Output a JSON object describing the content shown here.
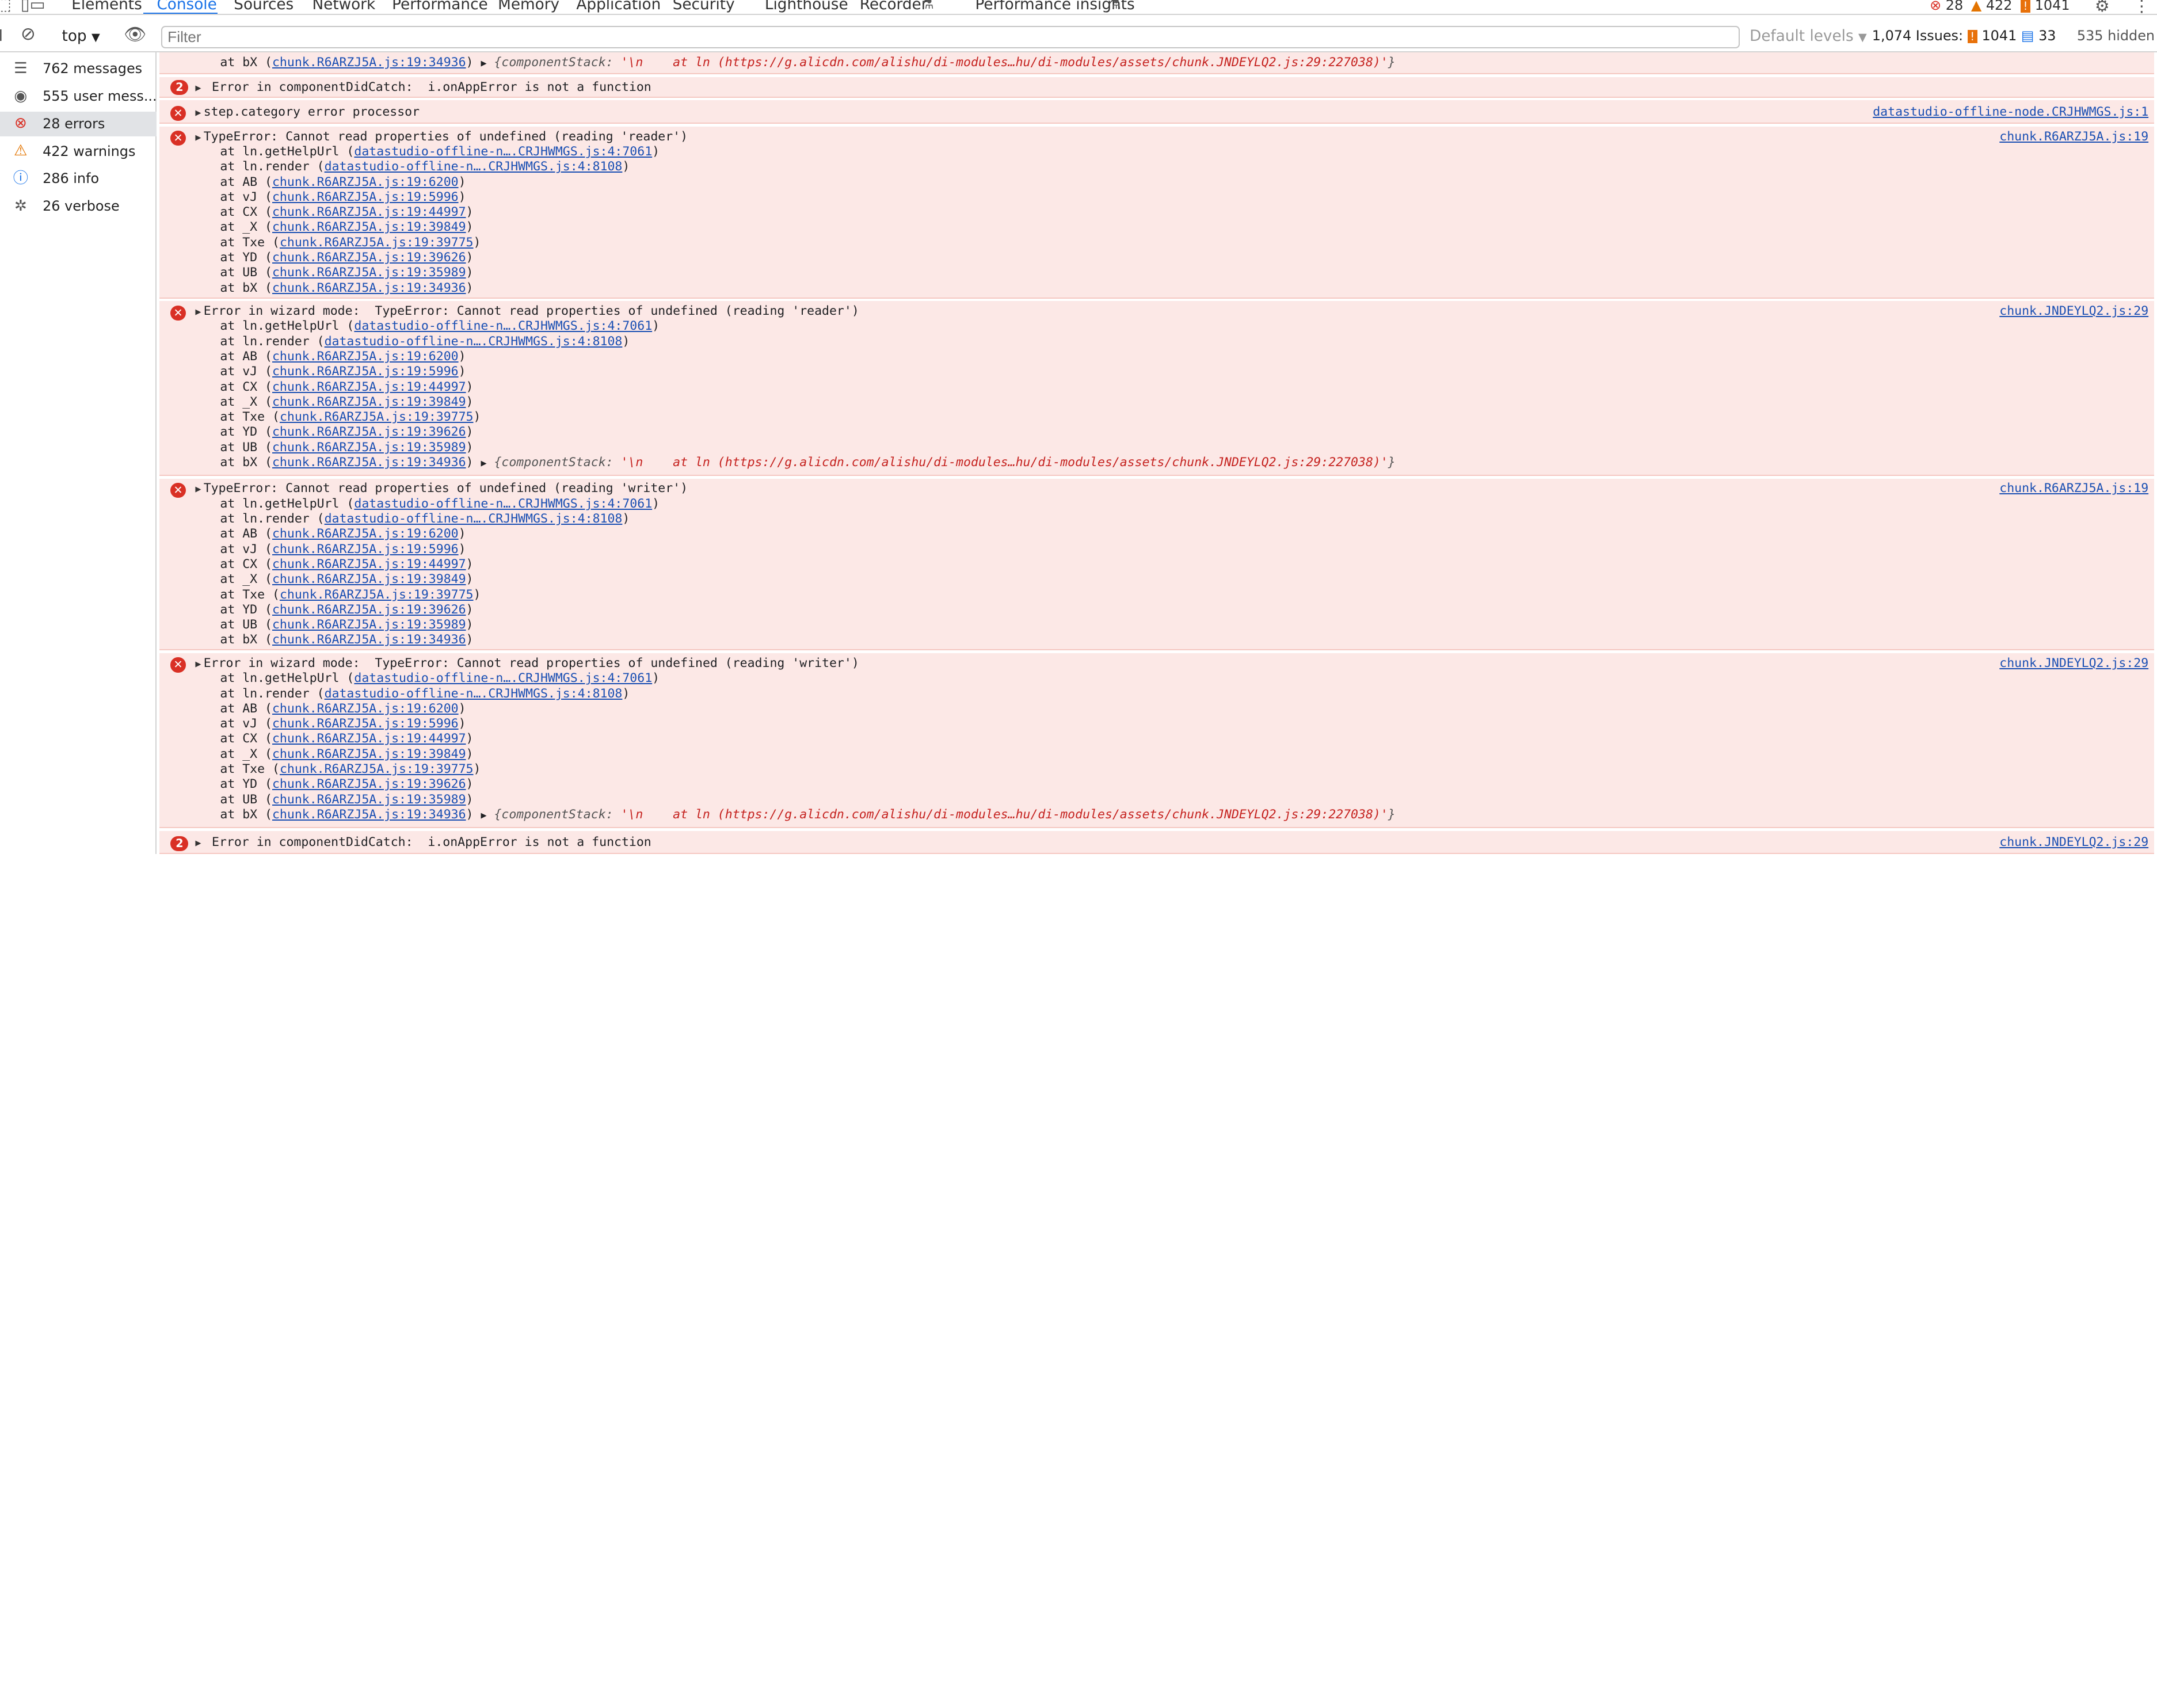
{
  "tabs": {
    "elements": "Elements",
    "console": "Console",
    "sources": "Sources",
    "network": "Network",
    "performance": "Performance",
    "memory": "Memory",
    "application": "Application",
    "security": "Security",
    "lighthouse": "Lighthouse",
    "recorder": "Recorder",
    "perf_insights": "Performance insights"
  },
  "header_counts": {
    "errors": "28",
    "warnings": "422",
    "issues": "1041"
  },
  "toolbar": {
    "context": "top",
    "filter_placeholder": "Filter",
    "levels": "Default levels",
    "issues_label": "1,074 Issues:",
    "issues_errors": "1041",
    "issues_info": "33",
    "hidden": "535 hidden"
  },
  "sidebar": [
    {
      "label": "762 messages",
      "icon": "list-icon"
    },
    {
      "label": "555 user mess...",
      "icon": "user-icon"
    },
    {
      "label": "28 errors",
      "icon": "error-icon"
    },
    {
      "label": "422 warnings",
      "icon": "warning-icon"
    },
    {
      "label": "286 info",
      "icon": "info-icon"
    },
    {
      "label": "26 verbose",
      "icon": "bug-icon"
    }
  ],
  "stack": {
    "getHelpUrl": "at ln.getHelpUrl (",
    "render": "at ln.render (",
    "AB": "at AB (",
    "vJ": "at vJ (",
    "CX": "at CX (",
    "X": "at _X (",
    "Txe": "at Txe (",
    "YD": "at YD (",
    "UB": "at UB (",
    "bX": "at bX (",
    "close": ")",
    "links": {
      "getHelpUrl": "datastudio-offline-n….CRJHWMGS.js:4:7061",
      "render": "datastudio-offline-n….CRJHWMGS.js:4:8108",
      "AB": "chunk.R6ARZJ5A.js:19:6200",
      "vJ": "chunk.R6ARZJ5A.js:19:5996",
      "CX": "chunk.R6ARZJ5A.js:19:44997",
      "X": "chunk.R6ARZJ5A.js:19:39849",
      "Txe": "chunk.R6ARZJ5A.js:19:39775",
      "YD": "chunk.R6ARZJ5A.js:19:39626",
      "UB": "chunk.R6ARZJ5A.js:19:35989",
      "bX": "chunk.R6ARZJ5A.js:19:34936"
    }
  },
  "component_stack": {
    "key": "componentStack",
    "prefix": "{",
    "colon": ": ",
    "value": "'\\n    at ln (https://g.alicdn.com/alishu/di-modules…hu/di-modules/assets/chunk.JNDEYLQ2.js:29:227038)'",
    "suffix": "}"
  },
  "messages": {
    "m1": {
      "count": "2",
      "text": "Error in componentDidCatch:  i.onAppError is not a function"
    },
    "m2": {
      "text": "step.category error processor",
      "source": "datastudio-offline-node.CRJHWMGS.js:1"
    },
    "m3": {
      "text": "TypeError: Cannot read properties of undefined (reading 'reader')",
      "source": "chunk.R6ARZJ5A.js:19"
    },
    "m4": {
      "text": "Error in wizard mode:  TypeError: Cannot read properties of undefined (reading 'reader')",
      "source": "chunk.JNDEYLQ2.js:29"
    },
    "m5": {
      "text": "TypeError: Cannot read properties of undefined (reading 'writer')",
      "source": "chunk.R6ARZJ5A.js:19"
    },
    "m6": {
      "text": "Error in wizard mode:  TypeError: Cannot read properties of undefined (reading 'writer')",
      "source": "chunk.JNDEYLQ2.js:29"
    },
    "m7": {
      "count": "2",
      "text": "Error in componentDidCatch:  i.onAppError is not a function",
      "source": "chunk.JNDEYLQ2.js:29"
    }
  },
  "colors": {
    "accent": "#1a73e8",
    "error_bg": "#fce8e6",
    "error_red": "#d93025",
    "link": "#1a4fb3"
  }
}
